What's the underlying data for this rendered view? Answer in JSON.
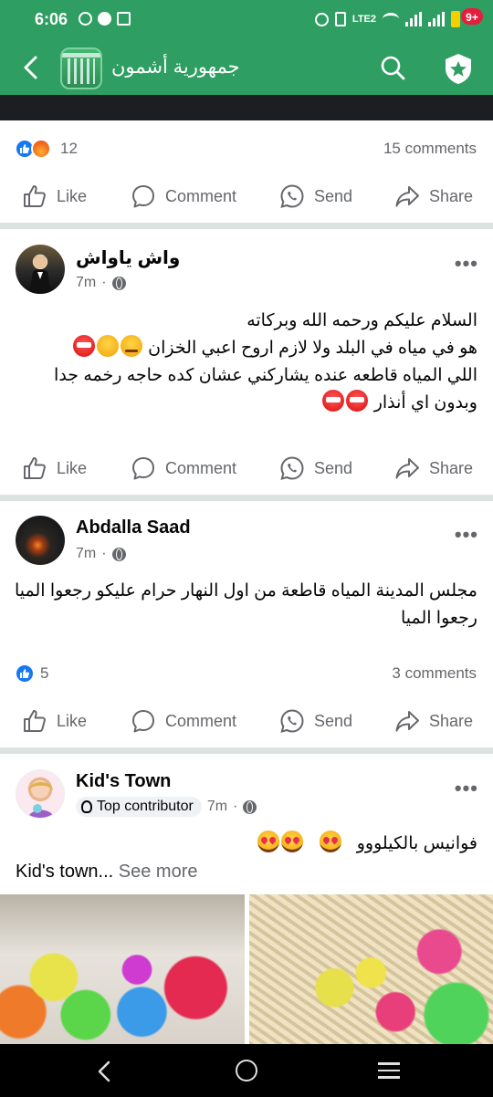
{
  "status_bar": {
    "time": "6:06",
    "lte_label": "LTE2"
  },
  "app_bar": {
    "title": "جمهورية أشمون",
    "notification_badge": "9+"
  },
  "top_post_footer": {
    "reaction_count": "12",
    "comments": "15 comments"
  },
  "actions": {
    "like": "Like",
    "comment": "Comment",
    "send": "Send",
    "share": "Share"
  },
  "posts": [
    {
      "author": "واش ياواش",
      "time": "7m",
      "lines": [
        "السلام عليكم ورحمه الله وبركاته",
        "هو في مياه في البلد ولا لازم اروح اعبي الخزان",
        "اللي المياه قاطعه عنده يشاركني عشان كده حاجه رخمه جدا",
        "وبدون اي أنذار"
      ]
    },
    {
      "author": "Abdalla Saad",
      "time": "7m",
      "lines": [
        "مجلس المدينة المياه قاطعة من اول النهار حرام عليكو رجعوا الميا",
        "رجعوا الميا"
      ],
      "reaction_count": "5",
      "comments": "3 comments"
    },
    {
      "author": "Kid's Town",
      "badge": "Top contributor",
      "time": "7m",
      "line": "فوانيس بالكيلووو",
      "preview": "Kid's town...",
      "see_more": "See more"
    }
  ],
  "colors": {
    "brand_green": "#2e9e62",
    "like_blue": "#1877f2",
    "badge_red": "#e41e3f"
  },
  "icons": [
    "back-arrow-icon",
    "search-icon",
    "shield-star-icon",
    "like-icon",
    "comment-icon",
    "whatsapp-icon",
    "share-icon",
    "globe-icon",
    "more-icon"
  ]
}
